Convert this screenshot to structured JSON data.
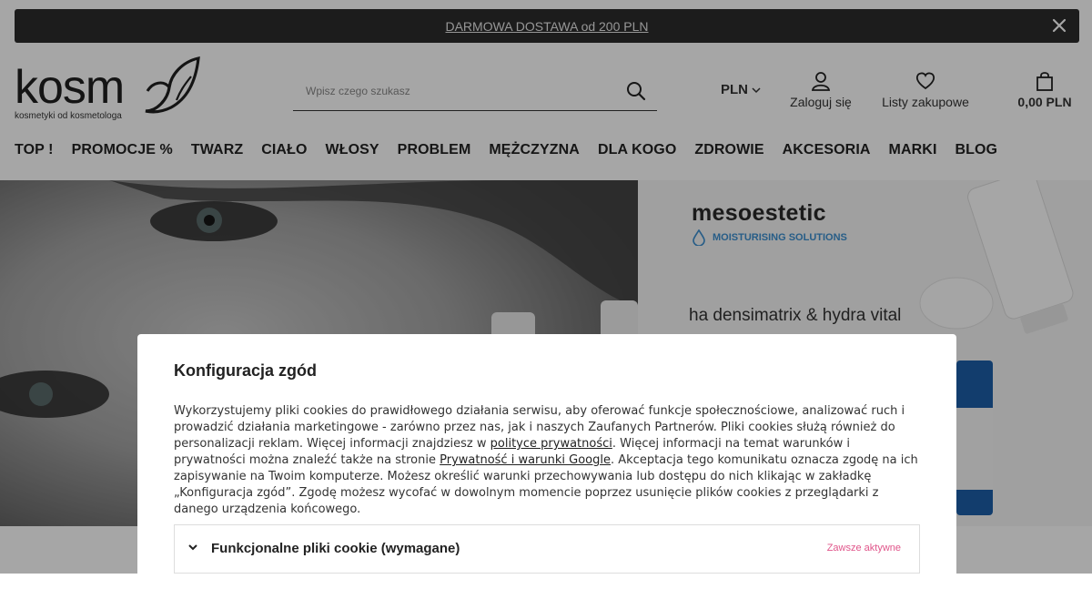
{
  "promo": {
    "text": "DARMOWA DOSTAWA od 200 PLN",
    "close_icon": "close-icon"
  },
  "header": {
    "logo_text": "kosm",
    "logo_tagline": "kosmetyki od kosmetologa",
    "search_placeholder": "Wpisz czego szukasz",
    "currency": "PLN",
    "login_label": "Zaloguj się",
    "lists_label": "Listy zakupowe",
    "cart_label": "0,00 PLN"
  },
  "nav": {
    "items": [
      "TOP !",
      "PROMOCJE %",
      "TWARZ",
      "CIAŁO",
      "WŁOSY",
      "PROBLEM",
      "MĘŻCZYZNA",
      "DLA KOGO",
      "ZDROWIE",
      "AKCESORIA",
      "MARKI",
      "BLOG"
    ]
  },
  "hero": {
    "brand": "mesoestetic",
    "subbrand": "MOISTURISING SOLUTIONS",
    "product_line": "ha densimatrix & hydra vital"
  },
  "modal": {
    "title": "Konfiguracja zgód",
    "text_1": "Wykorzystujemy pliki cookies do prawidłowego działania serwisu, aby oferować funkcje społecznościowe, analizować ruch i prowadzić działania marketingowe - zarówno przez nas, jak i naszych Zaufanych Partnerów. Pliki cookies służą również do personalizacji reklam. Więcej informacji znajdziesz w ",
    "link_privacy": "polityce prywatności",
    "text_2": ". Więcej informacji na temat warunków i prywatności można znaleźć także na stronie ",
    "link_google": "Prywatność i warunki Google",
    "text_3": ". Akceptacja tego komunikatu oznacza zgodę na ich zapisywanie na Twoim komputerze. Możesz określić warunki przechowywania lub dostępu do nich klikając w zakładkę „Konfiguracja zgód”. Zgodę możesz wycofać w dowolnym momencie poprzez usunięcie plików cookies z przeglądarki z danego urządzenia końcowego.",
    "section_title": "Funkcjonalne pliki cookie (wymagane)",
    "section_status": "Zawsze aktywne"
  },
  "colors": {
    "promo_bg": "#2b2b2b",
    "accent_pink": "#e0558a",
    "brand_blue": "#3c8fd0"
  }
}
